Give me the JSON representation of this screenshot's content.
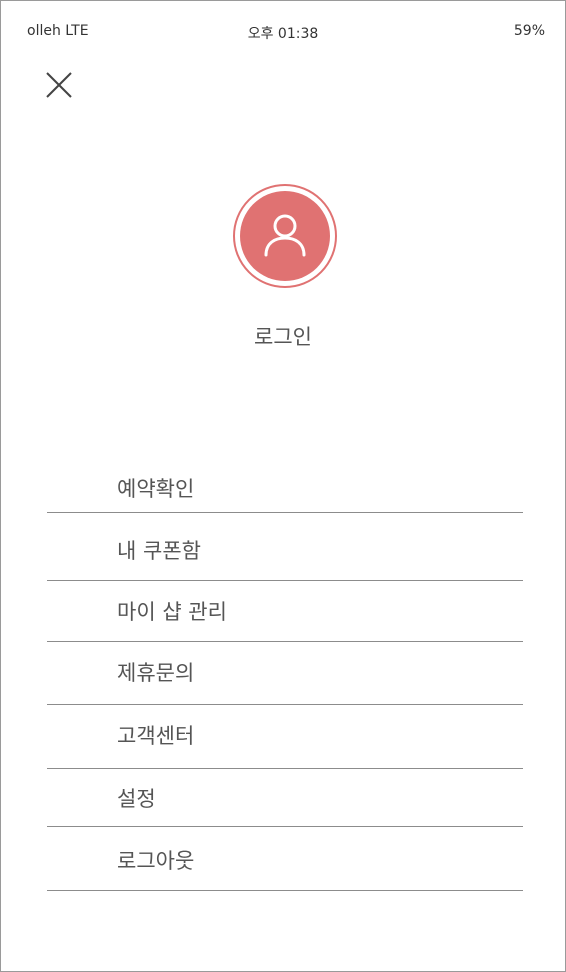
{
  "status_bar": {
    "carrier": "olleh LTE",
    "time": "오후 01:38",
    "battery": "59%"
  },
  "header": {
    "close_icon": "close-icon"
  },
  "profile": {
    "avatar_icon": "user-icon",
    "accent_color": "#e07272",
    "login_label": "로그인"
  },
  "menu": {
    "items": [
      {
        "label": "예약확인"
      },
      {
        "label": "내 쿠폰함"
      },
      {
        "label": "마이 샵 관리"
      },
      {
        "label": "제휴문의"
      },
      {
        "label": "고객센터"
      },
      {
        "label": "설정"
      },
      {
        "label": "로그아웃"
      }
    ]
  }
}
